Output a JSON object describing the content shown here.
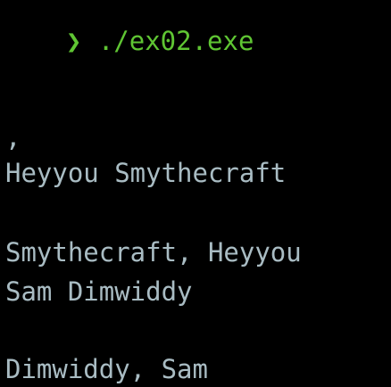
{
  "colors": {
    "background": "#000000",
    "prompt": "#5fc533",
    "output": "#a9bcc3"
  },
  "prompt": {
    "symbol": "❯",
    "command": "./ex02.exe"
  },
  "output": {
    "lines": [
      ",",
      "Heyyou Smythecraft",
      "Smythecraft, Heyyou",
      "Sam Dimwiddy",
      "Dimwiddy, Sam"
    ]
  }
}
